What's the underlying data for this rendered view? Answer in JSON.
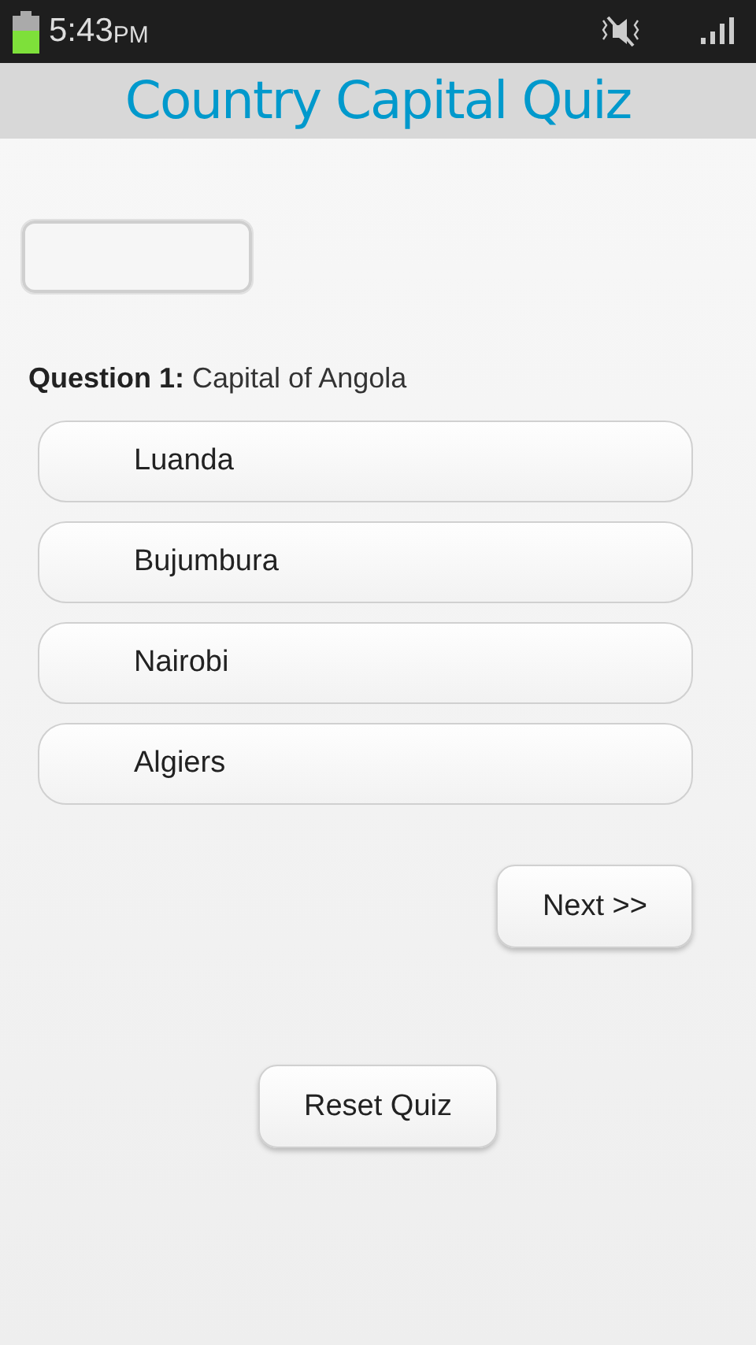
{
  "status_bar": {
    "time": "5:43",
    "meridiem": "PM"
  },
  "app_bar": {
    "title": "Country Capital Quiz"
  },
  "question": "**Question 1:** Capital of Angola",
  "options": [
    {
      "label": "Luanda"
    },
    {
      "label": "Bujumbura"
    },
    {
      "label": "Nairobi"
    },
    {
      "label": "Algiers"
    }
  ],
  "next_button": "Next >>",
  "reset_button": "Reset Quiz"
}
